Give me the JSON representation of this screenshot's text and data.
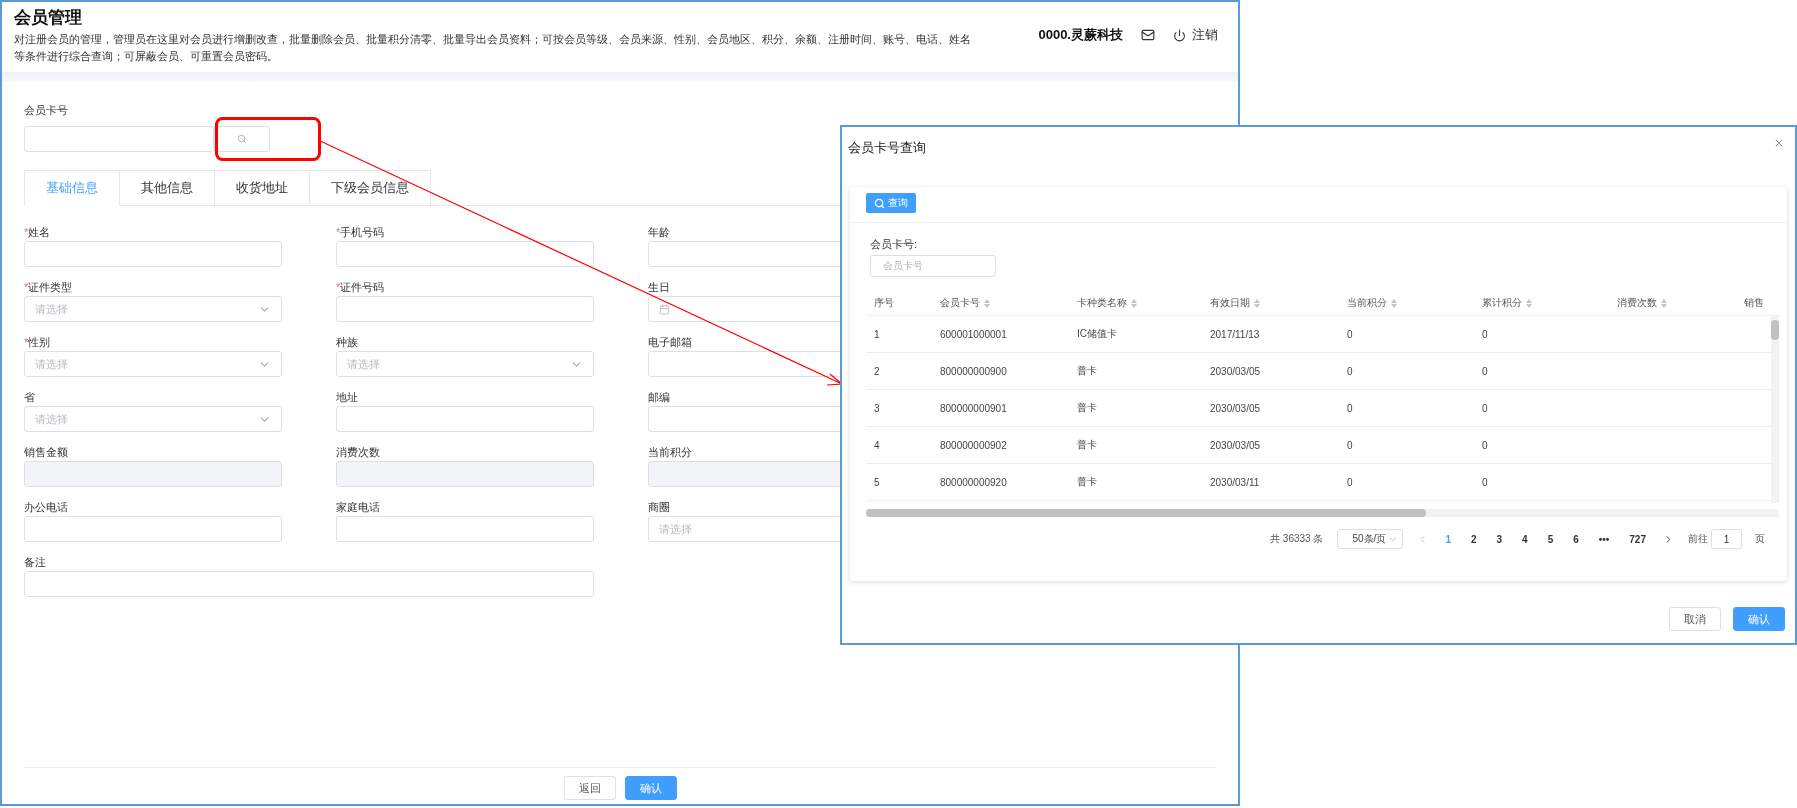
{
  "page": {
    "title": "会员管理",
    "description": "对注册会员的管理，管理员在这里对会员进行增删改查，批量删除会员、批量积分清零、批量导出会员资料；可按会员等级、会员来源、性别、会员地区、积分、余额、注册时间、账号、电话、姓名等条件进行综合查询；可屏蔽会员、可重置会员密码。",
    "company": "0000.灵蕨科技",
    "logout": "注销"
  },
  "member_card": {
    "label": "会员卡号"
  },
  "tabs": [
    {
      "label": "基础信息",
      "selected": true
    },
    {
      "label": "其他信息",
      "selected": false
    },
    {
      "label": "收货地址",
      "selected": false
    },
    {
      "label": "下级会员信息",
      "selected": false
    }
  ],
  "fields": [
    {
      "label": "姓名",
      "required_mark": "*",
      "kind": "text"
    },
    {
      "label": "手机号码",
      "required_mark": "*",
      "kind": "text"
    },
    {
      "label": "年龄",
      "kind": "text"
    },
    {
      "label": "证件类型",
      "required_mark": "*",
      "kind": "select",
      "placeholder": "请选择"
    },
    {
      "label": "证件号码",
      "required_mark": "*",
      "kind": "text"
    },
    {
      "label": "生日",
      "kind": "date"
    },
    {
      "label": "性别",
      "required_mark": "*",
      "kind": "select",
      "placeholder": "请选择"
    },
    {
      "label": "种族",
      "kind": "select",
      "placeholder": "请选择"
    },
    {
      "label": "电子邮箱",
      "kind": "text"
    },
    {
      "label": "省",
      "kind": "select",
      "placeholder": "请选择"
    },
    {
      "label": "地址",
      "kind": "text"
    },
    {
      "label": "邮编",
      "kind": "text"
    },
    {
      "label": "销售金额",
      "kind": "readonly"
    },
    {
      "label": "消费次数",
      "kind": "readonly"
    },
    {
      "label": "当前积分",
      "kind": "readonly"
    },
    {
      "label": "办公电话",
      "kind": "text"
    },
    {
      "label": "家庭电话",
      "kind": "text"
    },
    {
      "label": "商圈",
      "kind": "text",
      "placeholder": "请选择"
    },
    {
      "label": "备注",
      "kind": "wide"
    }
  ],
  "footer_buttons": [
    {
      "label": "返回",
      "primary": false
    },
    {
      "label": "确认",
      "primary": true
    }
  ],
  "dialog": {
    "title": "会员卡号查询",
    "query_button": "查询",
    "filter_label": "会员卡号:",
    "filter_placeholder": "会员卡号",
    "columns": [
      {
        "label": "序号",
        "sortable": false
      },
      {
        "label": "会员卡号",
        "sortable": true
      },
      {
        "label": "卡种类名称",
        "sortable": true
      },
      {
        "label": "有效日期",
        "sortable": true
      },
      {
        "label": "当前积分",
        "sortable": true
      },
      {
        "label": "累计积分",
        "sortable": true
      },
      {
        "label": "消费次数",
        "sortable": true
      },
      {
        "label": "销售",
        "sortable": false
      }
    ],
    "rows": [
      [
        "1",
        "600001000001",
        "IC储值卡",
        "2017/11/13",
        "0",
        "0"
      ],
      [
        "2",
        "800000000900",
        "普卡",
        "2030/03/05",
        "0",
        "0"
      ],
      [
        "3",
        "800000000901",
        "普卡",
        "2030/03/05",
        "0",
        "0"
      ],
      [
        "4",
        "800000000902",
        "普卡",
        "2030/03/05",
        "0",
        "0"
      ],
      [
        "5",
        "800000000920",
        "普卡",
        "2030/03/11",
        "0",
        "0"
      ]
    ],
    "pagination": {
      "total": "共 36333 条",
      "page_size": "50条/页",
      "pages": [
        {
          "label": "1",
          "selected": true
        },
        {
          "label": "2",
          "selected": false
        },
        {
          "label": "3",
          "selected": false
        },
        {
          "label": "4",
          "selected": false
        },
        {
          "label": "5",
          "selected": false
        },
        {
          "label": "6",
          "selected": false
        },
        {
          "label": "•••",
          "selected": false
        },
        {
          "label": "727",
          "selected": false
        }
      ],
      "goto_label": "前往",
      "goto_value": "1",
      "goto_suffix": "页"
    },
    "buttons": [
      {
        "label": "取消",
        "primary": false
      },
      {
        "label": "确认",
        "primary": true
      }
    ]
  }
}
